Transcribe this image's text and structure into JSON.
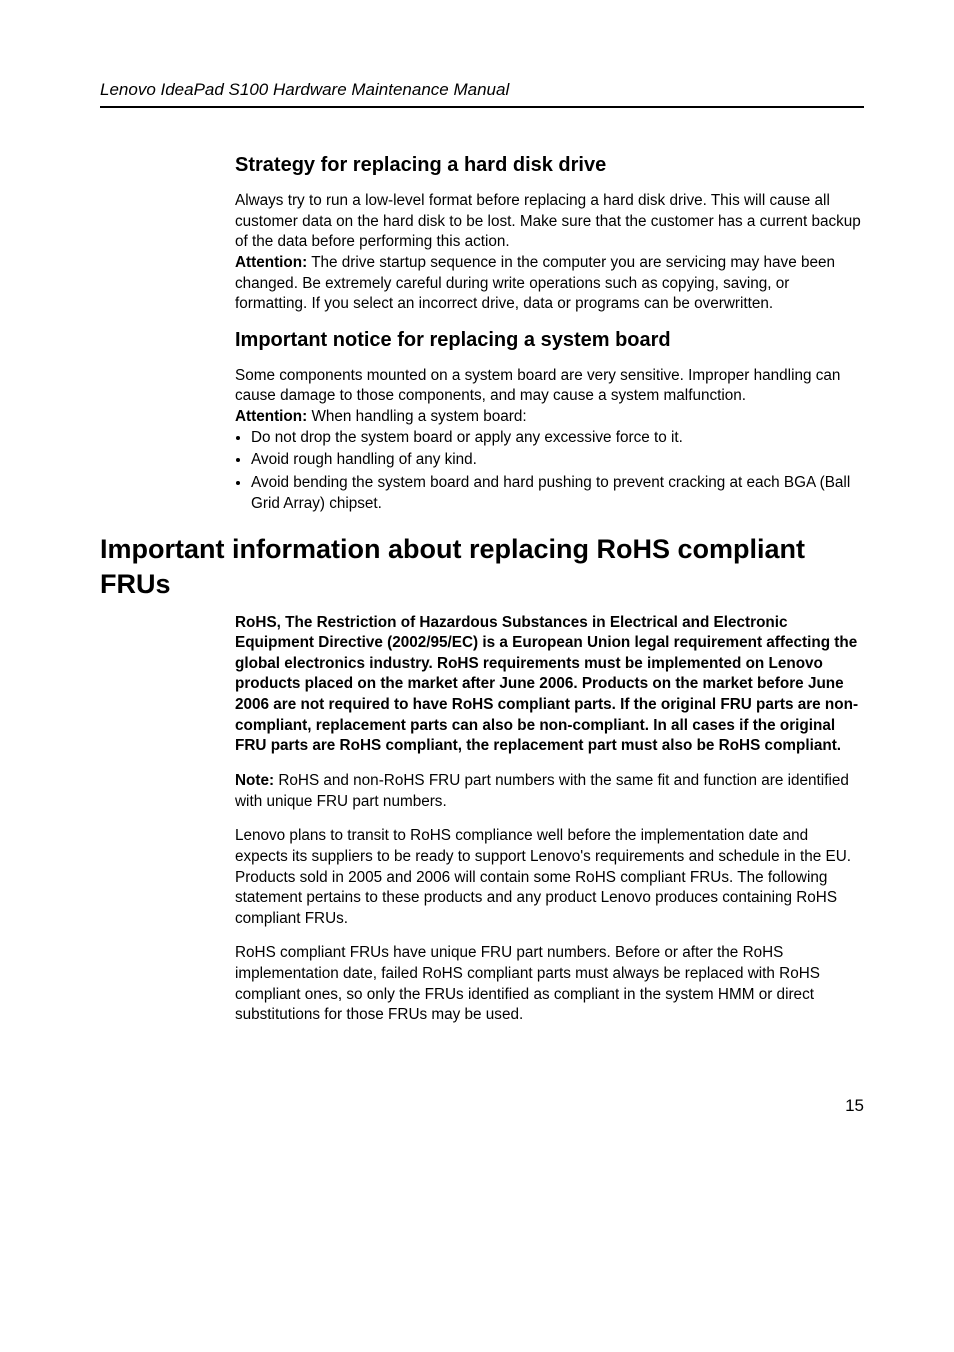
{
  "header": {
    "title": "Lenovo IdeaPad S100 Hardware Maintenance Manual"
  },
  "section1": {
    "heading": "Strategy for replacing a hard disk drive",
    "p1": "Always try to run a low-level format before replacing a hard disk drive. This will cause all customer data on the hard disk to be lost. Make sure that the customer has a current backup of the data before performing this action.",
    "attention_label": "Attention:",
    "attention_text": " The drive startup sequence in the computer you are servicing may have been changed. Be extremely careful during write operations such as copying, saving, or formatting. If you select an incorrect drive, data or programs can be overwritten."
  },
  "section2": {
    "heading": "Important notice for replacing a system board",
    "p1": "Some components mounted on a system board are very sensitive. Improper handling can cause damage to those components, and may cause a system malfunction.",
    "attention_label": "Attention:",
    "attention_text": " When handling a system board:",
    "bullets": [
      "Do not drop the system board or apply any excessive force to it.",
      "Avoid rough handling of any kind.",
      "Avoid bending the system board and hard pushing to prevent cracking at each BGA (Ball Grid Array) chipset."
    ]
  },
  "section3": {
    "heading": "Important information about replacing RoHS compliant FRUs",
    "bold_para": "RoHS, The Restriction of Hazardous Substances in Electrical and Electronic Equipment Directive (2002/95/EC) is a European Union legal requirement affecting the global electronics industry. RoHS requirements must be implemented on Lenovo products placed on the market after June 2006. Products on the market before June 2006 are not required to have RoHS compliant parts. If the original FRU parts are non-compliant, replacement parts can also be non-compliant. In all cases if the original FRU parts are RoHS compliant, the replacement part must also be RoHS compliant.",
    "note_label": "Note:",
    "note_text": " RoHS and non-RoHS FRU part numbers with the same fit and function are identified with unique FRU part numbers.",
    "p3": "Lenovo plans to transit to RoHS compliance well before the implementation date and expects its suppliers to be ready to support Lenovo's requirements and schedule in the EU. Products sold in 2005 and 2006 will contain some RoHS compliant FRUs. The following statement pertains to these products and any product Lenovo produces containing RoHS compliant FRUs.",
    "p4": "RoHS compliant FRUs have unique FRU part numbers. Before or after the RoHS implementation date, failed RoHS compliant parts must always be replaced with RoHS compliant ones, so only the FRUs identified as compliant in the system HMM or direct substitutions for those FRUs may be used."
  },
  "pagenum": "15"
}
